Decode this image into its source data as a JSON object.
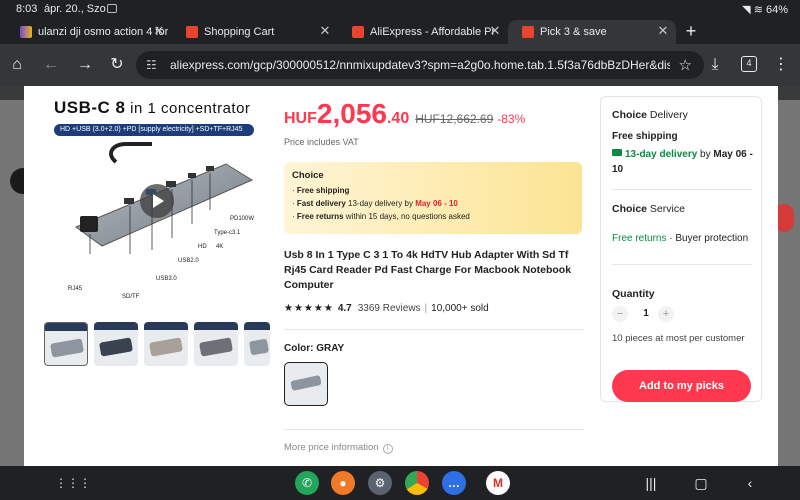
{
  "status": {
    "time": "8:03",
    "date": "ápr. 20., Szo",
    "battery": "64%"
  },
  "tabs": [
    {
      "title": "ulanzi dji osmo action 4 for",
      "favicon_color": "#7b4bd6"
    },
    {
      "title": "Shopping Cart",
      "favicon_color": "#e8442e"
    },
    {
      "title": "AliExpress - Affordable Price",
      "favicon_color": "#e8442e"
    },
    {
      "title": "Pick 3 & save",
      "favicon_color": "#e8442e"
    }
  ],
  "toolbar": {
    "url": "aliexpress.com/gcp/300000512/nnmixupdatev3?spm=a2g0o.home.tab.1.5f3a76dbBzDHer&disab",
    "tab_count": "4"
  },
  "image_banner": {
    "headline_a": "USB-C 8",
    "headline_b": " in 1 concentrator",
    "subline": "HD  +USB (3.0+2.0) +PD  [supply electricity]  +SD+TF+RJ45",
    "labels": [
      "PD100W",
      "Type-c3.1",
      "HD",
      "4K",
      "USB2.0",
      "USB3.0",
      "SD/TF",
      "RJ45"
    ]
  },
  "product": {
    "currency": "HUF",
    "price_int": "2,056",
    "price_dec": ".40",
    "old_price": "HUF12,662.69",
    "discount": "-83%",
    "vat_note": "Price includes VAT",
    "choice": {
      "title": "Choice",
      "line1": "Free shipping",
      "line2_bold": "Fast delivery",
      "line2_text": " 13-day delivery by ",
      "line2_date": "May 06 - 10",
      "line3_bold": "Free returns",
      "line3_text": "  within 15 days, no questions asked"
    },
    "title": "Usb 8 In 1 Type C 3 1 To 4k HdTV Hub Adapter With Sd Tf Rj45 Card Reader Pd Fast Charge For Macbook Notebook Computer",
    "stars": "★★★★★",
    "rating": "4.7",
    "reviews": "3369 Reviews",
    "sold": "10,000+ sold",
    "color_label": "Color: GRAY",
    "more_info": "More price information"
  },
  "panel": {
    "delivery_title_bold": "Choice",
    "delivery_title": " Delivery",
    "free_shipping": "Free shipping",
    "delivery_green": "13-day delivery",
    "delivery_by": " by ",
    "delivery_date": "May 06 - 10",
    "service_title_bold": "Choice",
    "service_title": " Service",
    "service_green": "Free returns",
    "service_rest": " · Buyer protection",
    "quantity_label": "Quantity",
    "quantity_value": "1",
    "minus": "−",
    "plus": "+",
    "limit_note": "10 pieces at most per customer",
    "add_button": "Add to my picks"
  }
}
